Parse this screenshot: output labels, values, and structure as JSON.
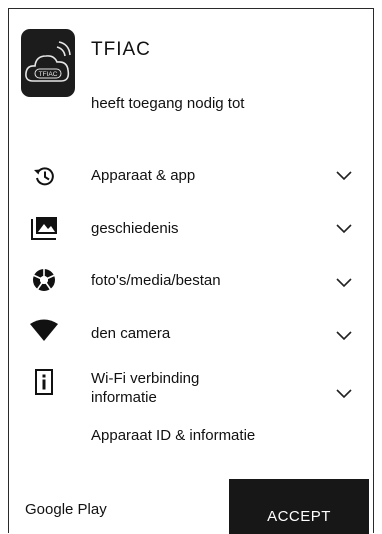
{
  "app": {
    "name": "TFIAC",
    "icon": "tfiac-cloud-wifi-icon",
    "icon_text": "TFIAC",
    "subtitle": "heeft toegang nodig tot"
  },
  "permissions": [
    {
      "icon": "history-icon",
      "label": "Apparaat & app",
      "expand_icon": "chevron-down-icon"
    },
    {
      "icon": "photo-icon",
      "label": "geschiedenis",
      "expand_icon": "chevron-down-icon"
    },
    {
      "icon": "camera-shutter-icon",
      "label": "foto's/media/bestan",
      "expand_icon": "chevron-down-icon"
    },
    {
      "icon": "wifi-icon",
      "label": "den camera",
      "expand_icon": "chevron-down-icon"
    },
    {
      "icon": "device-info-icon",
      "label_line1": "Wi-Fi verbinding",
      "label_line2": "informatie",
      "expand_icon": "chevron-down-icon"
    }
  ],
  "extra_line": "Apparaat ID & informatie",
  "footer": {
    "store_label": "Google Play",
    "accept_label": "ACCEPT"
  },
  "colors": {
    "button_bg": "#171717",
    "button_text": "#ffffff",
    "icon_bg": "#1c1c1c",
    "text": "#111111"
  }
}
